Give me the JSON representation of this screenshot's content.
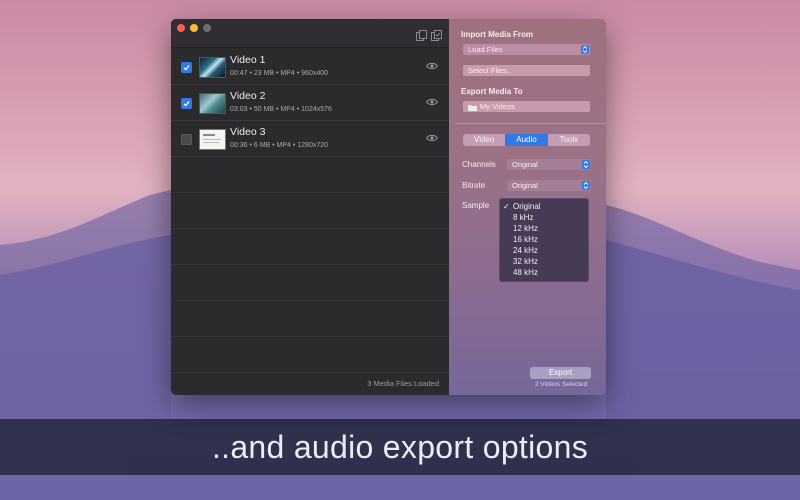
{
  "caption": "..and audio export options",
  "left_pane": {
    "videos": [
      {
        "title": "Video 1",
        "meta": "00:47 • 23 MB • MP4 • 960x400",
        "checked": true
      },
      {
        "title": "Video 2",
        "meta": "03:03 • 50 MB • MP4 • 1024x576",
        "checked": true
      },
      {
        "title": "Video 3",
        "meta": "00:36 • 6 MB • MP4 • 1280x720",
        "checked": false
      }
    ],
    "status": "3 Media Files Loaded"
  },
  "right_pane": {
    "import_label": "Import Media From",
    "load_files": "Load Files",
    "select_files": "Select Files..",
    "export_label": "Export Media To",
    "my_videos": "My Videos",
    "tabs": [
      "Video",
      "Audio",
      "Tools"
    ],
    "active_tab": "Audio",
    "channels_label": "Channels",
    "channels_value": "Original",
    "bitrate_label": "Bitrate",
    "bitrate_value": "Original",
    "sample_label": "Sample",
    "sample_options": [
      "Original",
      "8 kHz",
      "12 kHz",
      "16 kHz",
      "24 kHz",
      "32 kHz",
      "48 kHz"
    ],
    "selected_sample": "Original",
    "export_button": "Export",
    "export_status": "2 Videos Selected"
  },
  "colors": {
    "accent": "#2f7ae5",
    "caption_bg": "#2d2f4a",
    "list_bg": "#2b2a2d"
  },
  "icons": [
    "close-light",
    "minimize-light",
    "zoom-light",
    "copy-icon",
    "copy-check-icon",
    "checkmark-icon",
    "eye-icon",
    "folder-icon",
    "stepper-icon"
  ]
}
